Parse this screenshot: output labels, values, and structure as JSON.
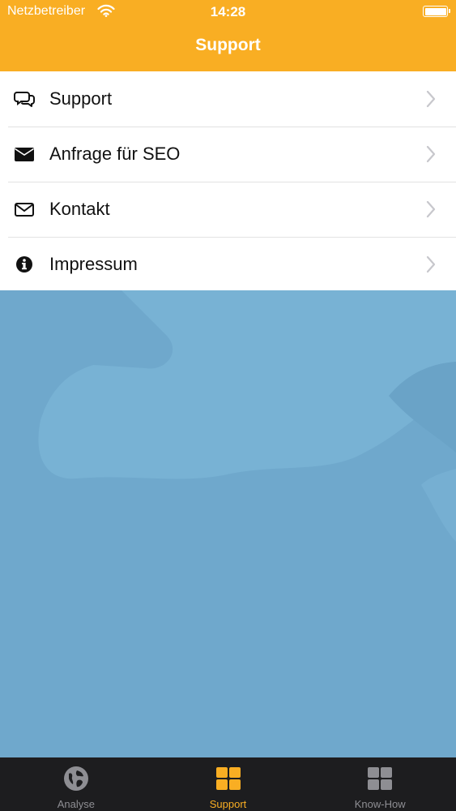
{
  "status": {
    "carrier": "Netzbetreiber",
    "time": "14:28"
  },
  "nav": {
    "title": "Support"
  },
  "menu": {
    "items": [
      {
        "label": "Support",
        "icon": "chat-bubbles-icon"
      },
      {
        "label": "Anfrage für SEO",
        "icon": "envelope-filled-icon"
      },
      {
        "label": "Kontakt",
        "icon": "envelope-outline-icon"
      },
      {
        "label": "Impressum",
        "icon": "info-circle-icon"
      }
    ]
  },
  "tabs": {
    "items": [
      {
        "label": "Analyse",
        "icon": "globe-icon",
        "active": false
      },
      {
        "label": "Support",
        "icon": "grid-icon",
        "active": true
      },
      {
        "label": "Know-How",
        "icon": "grid-icon",
        "active": false
      }
    ]
  },
  "colors": {
    "accent": "#f9ae23",
    "background": "#6fa8cc",
    "tabbar": "#1d1d1f",
    "tab_inactive": "#8e8e93"
  }
}
